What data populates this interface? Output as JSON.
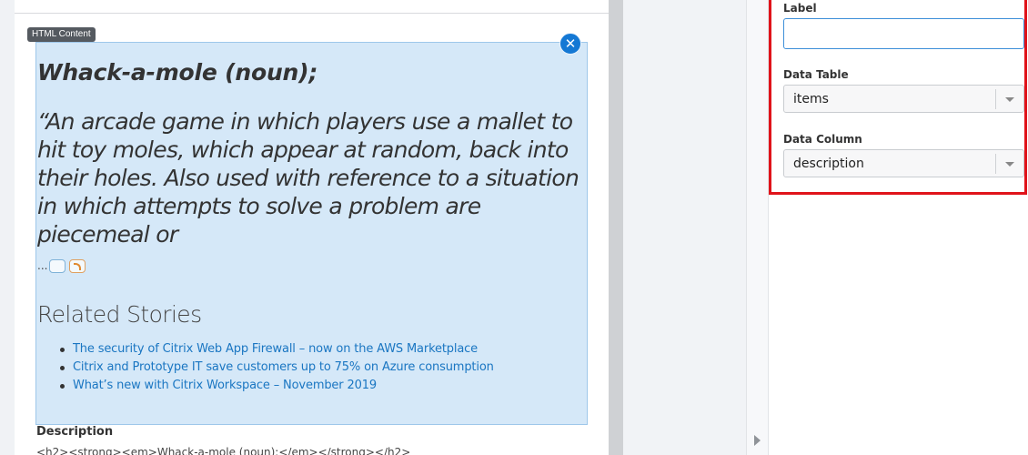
{
  "widget": {
    "tag": "HTML Content",
    "close_glyph": "✕",
    "title": "Whack-a-mole (noun);",
    "quote_lines": [
      "“An arcade game in which players use a mallet to",
      "hit toy moles, which appear at random, back into",
      "their holes. Also used with reference to a situation",
      "in which attempts to solve a problem are",
      "piecemeal or"
    ],
    "ellipsis": "...",
    "related_heading": "Related Stories",
    "related_links": [
      "The security of Citrix Web App Firewall – now on the AWS Marketplace",
      "Citrix and Prototype IT save customers up to 75% on Azure consumption",
      "What’s new with Citrix Workspace – November 2019"
    ]
  },
  "description": {
    "label": "Description",
    "code": "<h2><strong><em>Whack-a-mole (noun);</em></strong></h2>"
  },
  "properties": {
    "label_field": {
      "label": "Label",
      "value": ""
    },
    "data_table": {
      "label": "Data Table",
      "value": "items"
    },
    "data_column": {
      "label": "Data Column",
      "value": "description"
    }
  },
  "colors": {
    "highlight_border": "#e0131a",
    "link": "#1a76c2",
    "widget_background": "#d5e8f8",
    "accent": "#1478d4"
  },
  "icons": [
    "close-icon",
    "comment-icon",
    "rss-icon",
    "chevron-down-icon",
    "collapse-arrow-icon"
  ]
}
